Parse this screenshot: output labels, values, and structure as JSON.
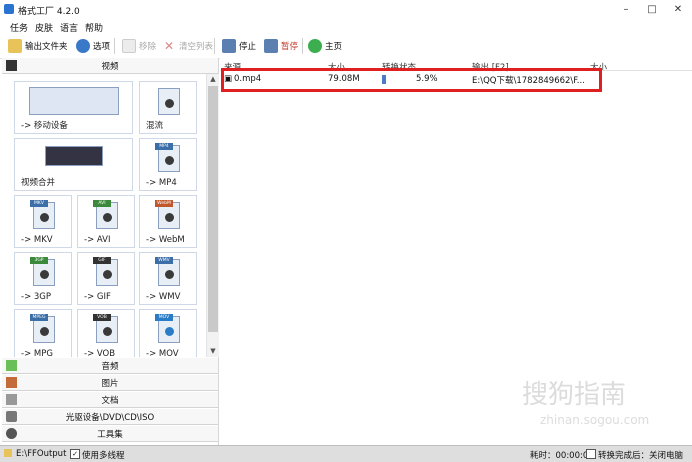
{
  "window": {
    "title": "格式工厂 4.2.0",
    "minimize": "–",
    "maximize": "□",
    "close": "✕"
  },
  "menu": [
    "任务",
    "皮肤",
    "语言",
    "帮助"
  ],
  "toolbar": {
    "output_folder": "输出文件夹",
    "options": "选项",
    "remove": "移除",
    "clear_list": "清空列表",
    "stop": "停止",
    "pause": "暂停",
    "home": "主页"
  },
  "left": {
    "category_video": "视频",
    "tiles": [
      {
        "label": "-> 移动设备",
        "icon": "mobile-devices-icon"
      },
      {
        "label": "混流",
        "icon": "mux-icon"
      },
      {
        "label": "视频合并",
        "icon": "video-merge-icon"
      },
      {
        "label": "-> MP4",
        "tag": "MP4",
        "icon": "mp4-file-icon"
      },
      {
        "label": "-> MKV",
        "tag": "MKV",
        "icon": "mkv-file-icon"
      },
      {
        "label": "-> AVI",
        "tag": "AVI",
        "icon": "avi-file-icon"
      },
      {
        "label": "-> WebM",
        "tag": "WebM",
        "icon": "webm-file-icon"
      },
      {
        "label": "-> 3GP",
        "tag": "3GP",
        "icon": "3gp-file-icon"
      },
      {
        "label": "-> GIF",
        "tag": "GIF",
        "icon": "gif-file-icon"
      },
      {
        "label": "-> WMV",
        "tag": "WMV",
        "icon": "wmv-file-icon"
      },
      {
        "label": "-> MPG",
        "tag": "MPEG",
        "icon": "mpg-file-icon"
      },
      {
        "label": "-> VOB",
        "tag": "VOB",
        "icon": "vob-file-icon"
      },
      {
        "label": "-> MOV",
        "tag": "MOV",
        "icon": "mov-file-icon"
      }
    ],
    "category_audio": "音频",
    "category_image": "图片",
    "category_document": "文档",
    "category_disc": "光驱设备\\DVD\\CD\\ISO",
    "category_tools": "工具集"
  },
  "table": {
    "headers": {
      "source": "来源",
      "size": "大小",
      "status": "转换状态",
      "output": "输出 [F2]",
      "out_size": "大小"
    },
    "rows": [
      {
        "source": "0.mp4",
        "size": "79.08M",
        "progress": "5.9%",
        "output": "E:\\QQ下载\\1782849662\\F..."
      }
    ]
  },
  "status": {
    "output_path": "E:\\FFOutput",
    "multithread": "使用多线程",
    "elapsed": "耗时：00:00:02",
    "after_convert": "转换完成后：关闭电脑"
  },
  "watermark": {
    "main": "搜狗指南",
    "sub": "zhinan.sogou.com"
  },
  "colors": {
    "accent": "#4d79c7",
    "highlight_box": "#e02020"
  }
}
